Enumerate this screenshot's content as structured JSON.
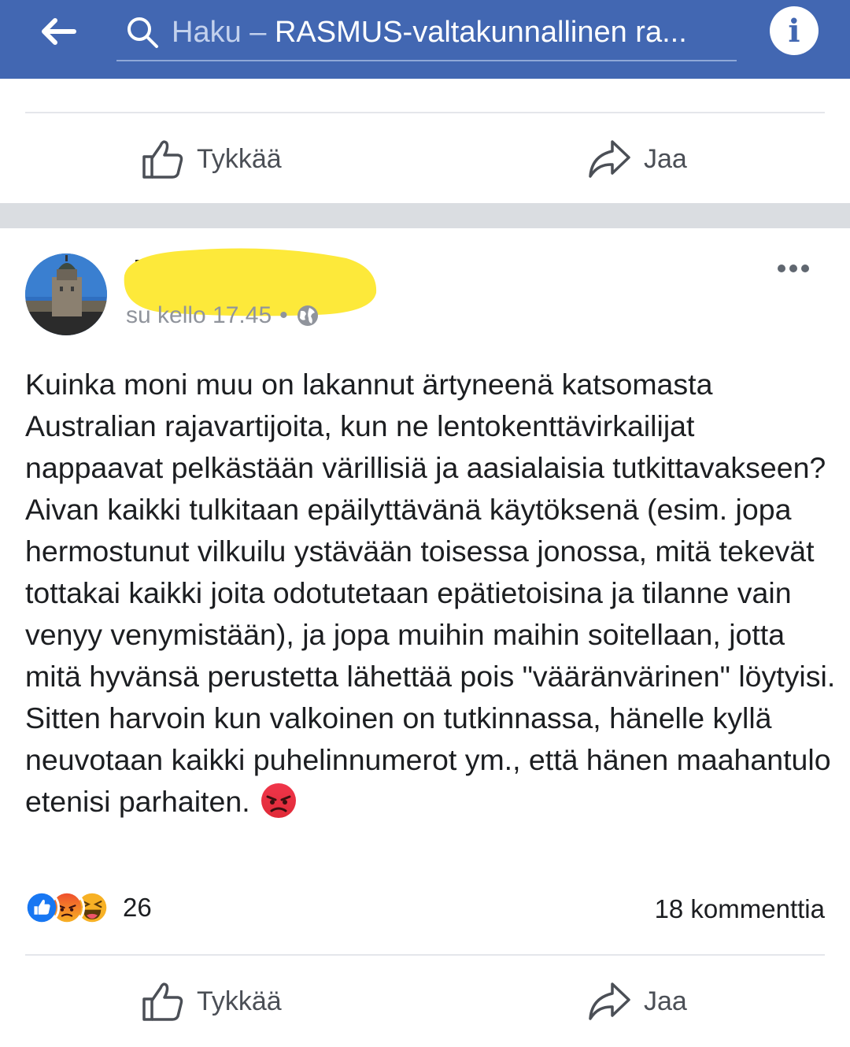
{
  "header": {
    "search_placeholder": "Haku",
    "search_dash": " – ",
    "search_group": "RASMUS-valtakunnallinen ra..."
  },
  "prev_post": {
    "like_label": "Tykkää",
    "share_label": "Jaa"
  },
  "post": {
    "timestamp": "su kello 17.45",
    "dot": "•",
    "text": "Kuinka moni muu on lakannut ärtyneenä katsomasta Australian rajavartijoita, kun ne lentokenttävirkailijat nappaavat pelkästään värillisiä ja aasialaisia tutkittavakseen? Aivan kaikki tulkitaan epäilyttävänä käytöksenä (esim. jopa hermostunut vilkuilu ystävään toisessa jonossa, mitä tekevät tottakai kaikki joita odotutetaan epätietoisina ja tilanne vain venyy venymistään), ja jopa muihin maihin soitellaan, jotta mitä hyvänsä perustetta lähettää pois \"vääränvärinen\" löytyisi. Sitten harvoin kun valkoinen on tutkinnassa, hänelle kyllä neuvotaan kaikki puhelinnumerot ym., että hänen maahantulo etenisi parhaiten.",
    "reaction_count": "26",
    "comments": "18 kommenttia",
    "like_label": "Tykkää",
    "share_label": "Jaa",
    "reactions": [
      "like-icon",
      "angry-icon",
      "haha-icon"
    ]
  },
  "colors": {
    "brand": "#4267b2",
    "like": "#1877f2",
    "angry": "#e9710f",
    "haha": "#f7b125"
  }
}
